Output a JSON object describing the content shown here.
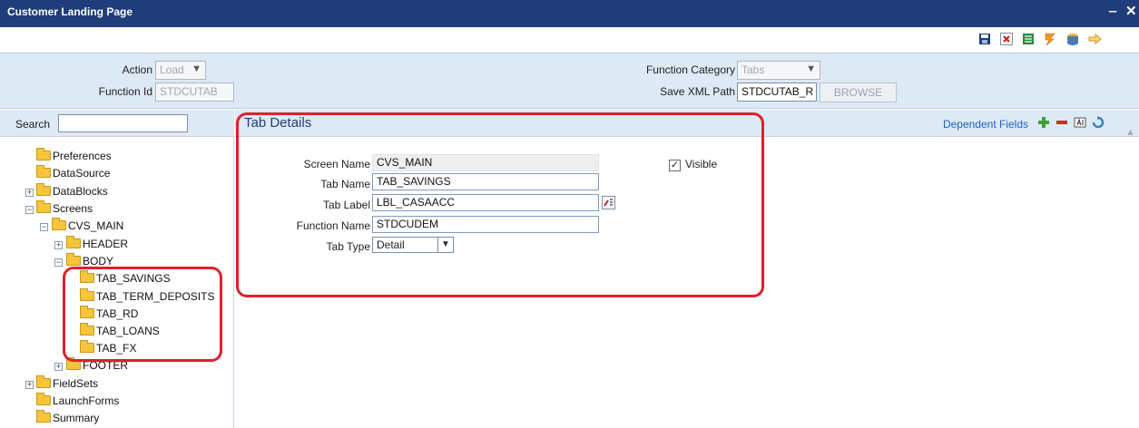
{
  "window": {
    "title": "Customer Landing Page",
    "minimize_glyph": "‒",
    "close_glyph": "✕"
  },
  "toolbar": {
    "icons": [
      "save-icon",
      "delete-icon",
      "list-icon",
      "generate-icon",
      "deploy-icon",
      "exit-icon"
    ]
  },
  "header": {
    "action_label": "Action",
    "action_value": "Load",
    "function_id_label": "Function Id",
    "function_id_value": "STDCUTAB",
    "function_category_label": "Function Category",
    "function_category_value": "Tabs",
    "save_xml_path_label": "Save XML Path",
    "save_xml_path_value": "STDCUTAB_R",
    "browse_label": "BROWSE"
  },
  "left": {
    "search_label": "Search",
    "search_value": "",
    "tree": [
      {
        "label": "Preferences"
      },
      {
        "label": "DataSource"
      },
      {
        "label": "DataBlocks",
        "expander": "+"
      },
      {
        "label": "Screens",
        "expander": "−"
      },
      {
        "label": "CVS_MAIN",
        "expander": "−"
      },
      {
        "label": "HEADER",
        "expander": "+"
      },
      {
        "label": "BODY",
        "expander": "−"
      },
      {
        "label": "TAB_SAVINGS"
      },
      {
        "label": "TAB_TERM_DEPOSITS"
      },
      {
        "label": "TAB_RD"
      },
      {
        "label": "TAB_LOANS"
      },
      {
        "label": "TAB_FX"
      },
      {
        "label": "FOOTER",
        "expander": "+"
      },
      {
        "label": "FieldSets",
        "expander": "+"
      },
      {
        "label": "LaunchForms"
      },
      {
        "label": "Summary"
      }
    ]
  },
  "tab_details": {
    "title": "Tab Details",
    "dependent_fields_label": "Dependent Fields",
    "screen_name_label": "Screen Name",
    "screen_name_value": "CVS_MAIN",
    "tab_name_label": "Tab Name",
    "tab_name_value": "TAB_SAVINGS",
    "tab_label_label": "Tab Label",
    "tab_label_value": "LBL_CASAACC",
    "function_name_label": "Function Name",
    "function_name_value": "STDCUDEM",
    "tab_type_label": "Tab Type",
    "tab_type_value": "Detail",
    "visible_label": "Visible",
    "visible_checked": true
  },
  "colors": {
    "titlebar": "#1f3d7a",
    "panel": "#dde9f5",
    "highlight": "#e0202a",
    "link": "#1e63c6"
  }
}
